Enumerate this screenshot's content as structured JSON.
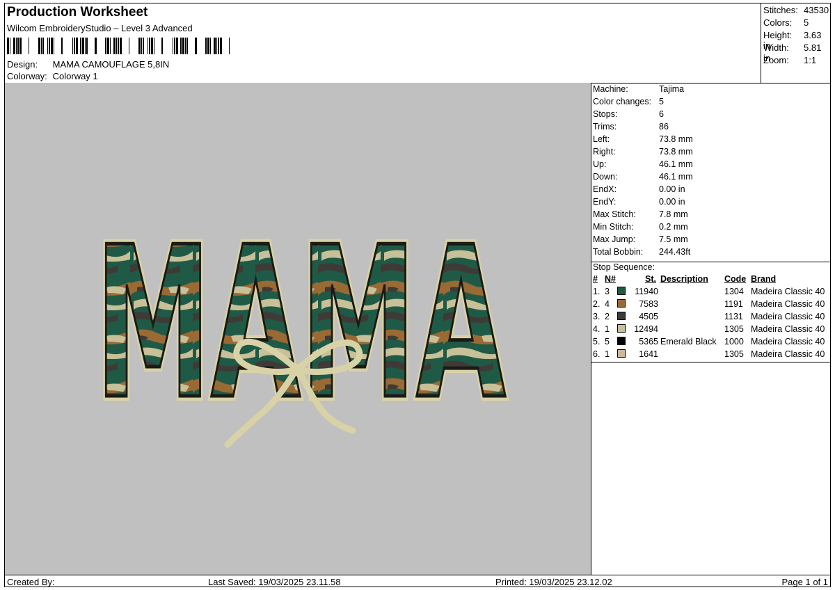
{
  "header": {
    "title": "Production Worksheet",
    "subtitle": "Wilcom EmbroideryStudio – Level 3 Advanced",
    "design_label": "Design:",
    "design_value": "MAMA CAMOUFLAGE 5,8IN",
    "colorway_label": "Colorway:",
    "colorway_value": "Colorway 1"
  },
  "summary": [
    {
      "label": "Stitches:",
      "value": "43530"
    },
    {
      "label": "Colors:",
      "value": "5"
    },
    {
      "label": "Height:",
      "value": "3.63 in"
    },
    {
      "label": "Width:",
      "value": "5.81 in"
    },
    {
      "label": "Zoom:",
      "value": "1:1"
    }
  ],
  "machine": [
    {
      "label": "Machine:",
      "value": "Tajima"
    },
    {
      "label": "Color changes:",
      "value": "5"
    },
    {
      "label": "Stops:",
      "value": "6"
    },
    {
      "label": "Trims:",
      "value": "86"
    },
    {
      "label": "Left:",
      "value": "73.8 mm"
    },
    {
      "label": "Right:",
      "value": "73.8 mm"
    },
    {
      "label": "Up:",
      "value": "46.1 mm"
    },
    {
      "label": "Down:",
      "value": "46.1 mm"
    },
    {
      "label": "EndX:",
      "value": "0.00 in"
    },
    {
      "label": "EndY:",
      "value": "0.00 in"
    },
    {
      "label": "Max Stitch:",
      "value": "7.8 mm"
    },
    {
      "label": "Min Stitch:",
      "value": "0.2 mm"
    },
    {
      "label": "Max Jump:",
      "value": "7.5 mm"
    },
    {
      "label": "Total Bobbin:",
      "value": "244.43ft"
    }
  ],
  "stop_sequence": {
    "label": "Stop Sequence:",
    "columns": {
      "num": "#",
      "n": "N#",
      "st": "St.",
      "description": "Description",
      "code": "Code",
      "brand": "Brand"
    },
    "rows": [
      {
        "num": "1.",
        "n": "3",
        "color": "#1f5a46",
        "st": "11940",
        "description": "",
        "code": "1304",
        "brand": "Madeira Classic 40"
      },
      {
        "num": "2.",
        "n": "4",
        "color": "#9a6a34",
        "st": "7583",
        "description": "",
        "code": "1191",
        "brand": "Madeira Classic 40"
      },
      {
        "num": "3.",
        "n": "2",
        "color": "#3e3b36",
        "st": "4505",
        "description": "",
        "code": "1131",
        "brand": "Madeira Classic 40"
      },
      {
        "num": "4.",
        "n": "1",
        "color": "#c7c098",
        "st": "12494",
        "description": "",
        "code": "1305",
        "brand": "Madeira Classic 40"
      },
      {
        "num": "5.",
        "n": "5",
        "color": "#000000",
        "st": "5365",
        "description": "Emerald Black",
        "code": "1000",
        "brand": "Madeira Classic 40"
      },
      {
        "num": "6.",
        "n": "1",
        "color": "#c9b99a",
        "st": "1641",
        "description": "",
        "code": "1305",
        "brand": "Madeira Classic 40"
      }
    ]
  },
  "design_text": "MAMA",
  "footer": {
    "created": "Created By:",
    "saved": "Last Saved: 19/03/2025 23.11.58",
    "printed": "Printed: 19/03/2025 23.12.02",
    "page": "Page 1 of 1"
  }
}
